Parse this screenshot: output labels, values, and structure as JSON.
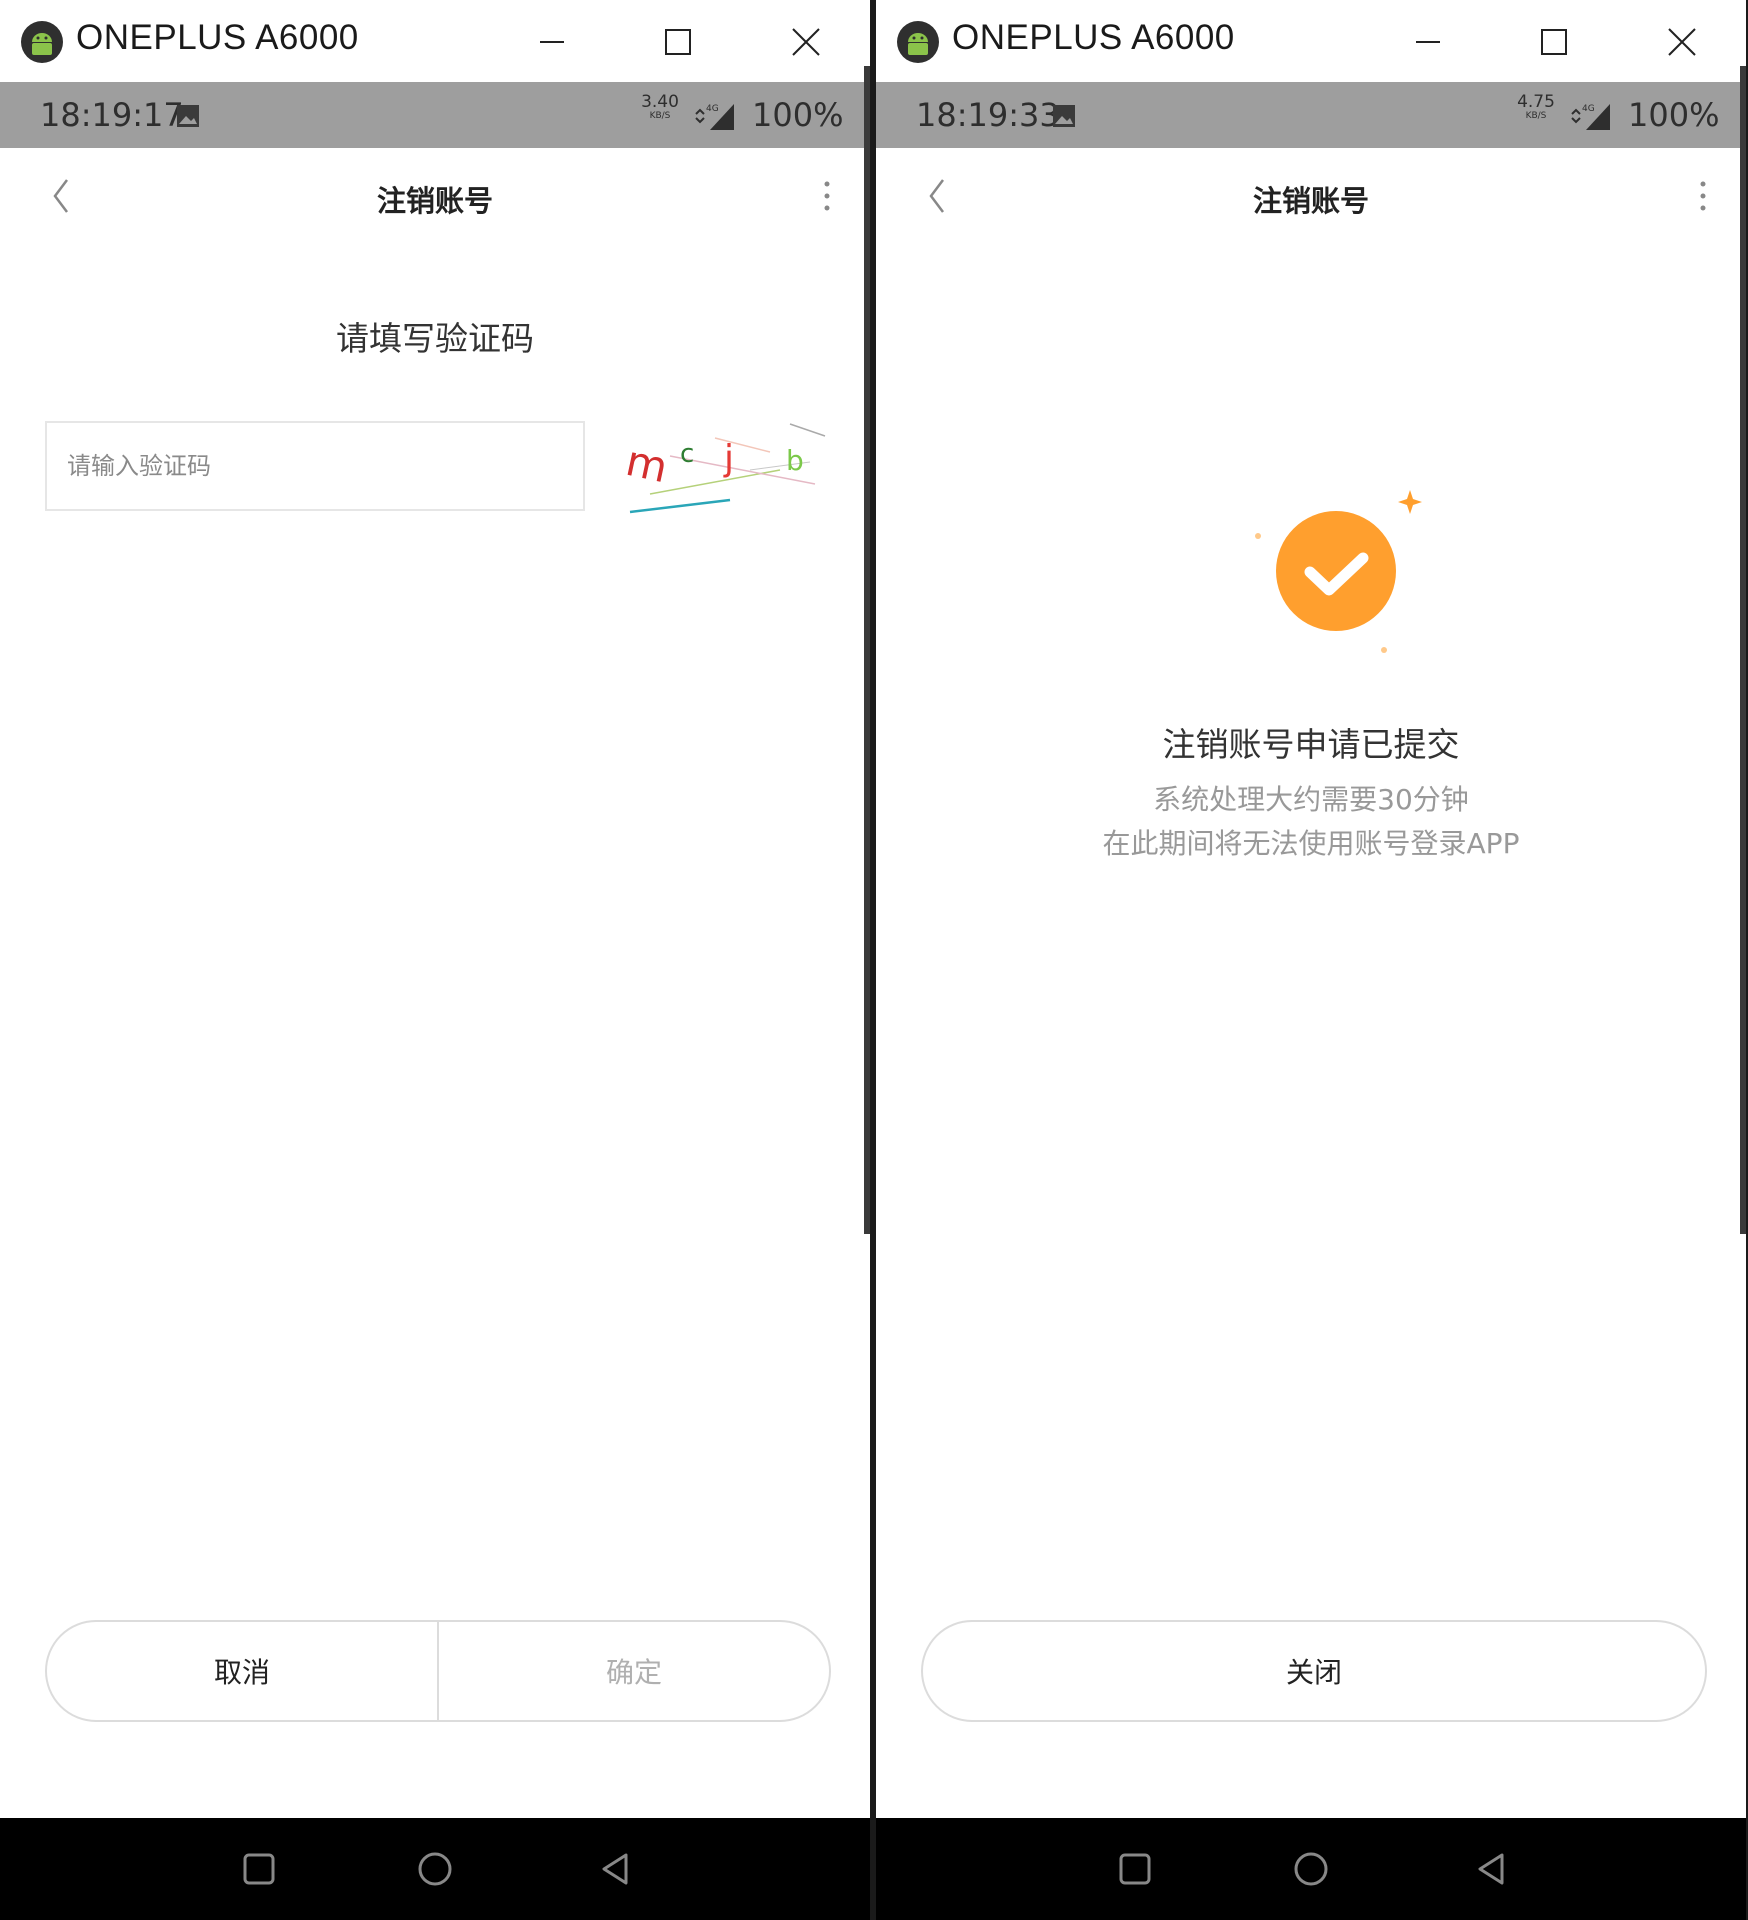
{
  "windows": [
    {
      "title": "ONEPLUS A6000",
      "status": {
        "time": "18:19:17",
        "speed_value": "3.40",
        "speed_unit": "KB/S",
        "network": "4G",
        "battery": "100%"
      },
      "appbar": {
        "title": "注销账号"
      },
      "content": {
        "heading": "请填写验证码",
        "input_placeholder": "请输入验证码",
        "captcha_chars": [
          "m",
          "c",
          "j",
          "b"
        ]
      },
      "buttons": {
        "cancel": "取消",
        "confirm": "确定"
      }
    },
    {
      "title": "ONEPLUS A6000",
      "status": {
        "time": "18:19:33",
        "speed_value": "4.75",
        "speed_unit": "KB/S",
        "network": "4G",
        "battery": "100%"
      },
      "appbar": {
        "title": "注销账号"
      },
      "content": {
        "success_title": "注销账号申请已提交",
        "success_line1": "系统处理大约需要30分钟",
        "success_line2": "在此期间将无法使用账号登录APP"
      },
      "buttons": {
        "close": "关闭"
      }
    }
  ],
  "colors": {
    "accent_orange": "#FF9F2E",
    "status_bar": "#9E9E9E",
    "nav_bar": "#000000"
  },
  "icons": {
    "app": "android-icon",
    "minimize": "minimize-icon",
    "maximize": "maximize-icon",
    "close": "close-icon",
    "back": "chevron-left-icon",
    "more": "more-vertical-icon",
    "nav_recents": "square-icon",
    "nav_home": "circle-icon",
    "nav_back": "triangle-back-icon",
    "success": "check-circle-icon"
  }
}
